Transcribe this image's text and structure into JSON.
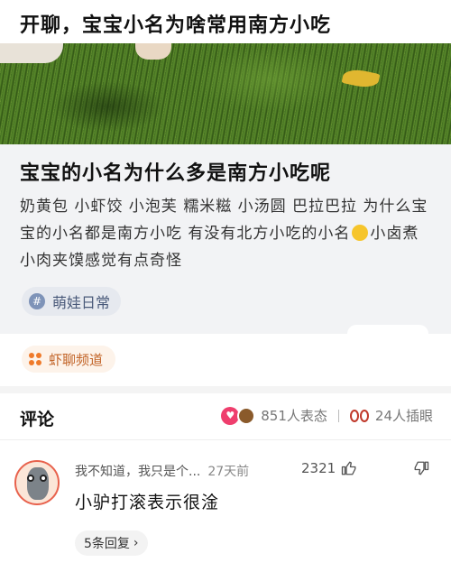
{
  "page": {
    "title": "开聊，宝宝小名为啥常用南方小吃"
  },
  "post": {
    "title": "宝宝的小名为什么多是南方小吃呢",
    "body_part1": "奶黄包 小虾饺 小泡芙 糯米糍 小汤圆 巴拉巴拉 为什么宝宝的小名都是南方小吃 有没有北方小吃的小名",
    "body_part2": "小卤煮 小肉夹馍感觉有点奇怪",
    "topic_tag": "萌娃日常"
  },
  "channel": {
    "label": "虾聊频道"
  },
  "comments": {
    "title": "评论",
    "reactions_count": "851人表态",
    "illustrations_count": "24人插眼"
  },
  "comment": {
    "user_text": "我不知道，我只是个...",
    "time": "27天前",
    "likes": "2321",
    "text": "小驴打滚表示很淦",
    "replies_label": "5条回复",
    "replies_arrow": "›"
  },
  "icons": {
    "topic": "hashtag-icon",
    "channel": "dots-icon",
    "reaction_heart": "heart-icon",
    "reaction_poop": "poop-icon",
    "eyes": "eyes-icon",
    "like": "thumbs-up-icon",
    "dislike": "thumbs-down-icon"
  },
  "colors": {
    "accent": "#ef7a2a",
    "heart": "#ef3e6d",
    "topic_tag_text": "#4a5a7a"
  }
}
